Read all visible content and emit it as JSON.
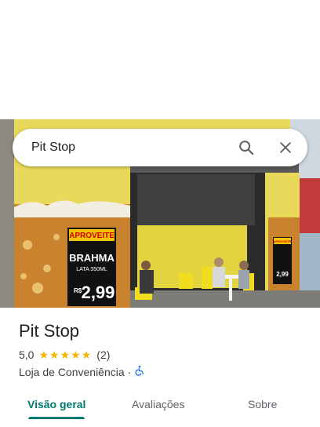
{
  "search": {
    "query": "Pit Stop"
  },
  "photo": {
    "sign_aproveite": "APROVEITE",
    "sign_brand": "BRAHMA",
    "sign_size": "LATA 350ML",
    "sign_prefix": "R$",
    "sign_price": "2,99",
    "sign_small_header": "APROVEITE",
    "sign_small_price": "2,99"
  },
  "place": {
    "name": "Pit Stop",
    "rating": "5,0",
    "star_count": 5,
    "reviews": "(2)",
    "category": "Loja de Conveniência",
    "separator": "·"
  },
  "tabs": [
    {
      "label": "Visão geral",
      "active": true
    },
    {
      "label": "Avaliações",
      "active": false
    },
    {
      "label": "Sobre",
      "active": false
    }
  ],
  "colors": {
    "accent": "#01796f",
    "star": "#f5b400"
  }
}
